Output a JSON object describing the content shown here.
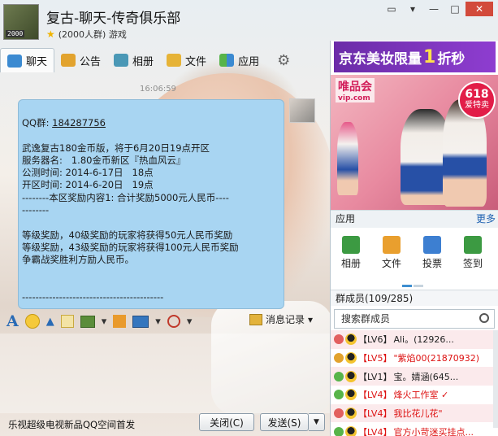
{
  "header": {
    "title": "复古-聊天-传奇俱乐部",
    "badge": "2000",
    "subtitle": "(2000人群) 游戏",
    "window_buttons": [
      "▭",
      "▾",
      "—",
      "□",
      "✕"
    ]
  },
  "tabs": [
    {
      "label": "聊天",
      "icon": "chat-icon"
    },
    {
      "label": "公告",
      "icon": "notice-icon"
    },
    {
      "label": "相册",
      "icon": "album-icon"
    },
    {
      "label": "文件",
      "icon": "folder-icon"
    },
    {
      "label": "应用",
      "icon": "apps-icon"
    }
  ],
  "message": {
    "timestamp": "16:06:59",
    "lines": [
      "QQ群: ",
      "",
      "武逸复古180金币版，将于6月20日19点开区",
      "服务器名:   1.80金币新区『热血风云』",
      "公测时间: 2014-6-17日   18点",
      "开区时间: 2014-6-20日   19点",
      "--------本区奖励内容1: 合计奖励5000元人民币----",
      "--------",
      "",
      "等级奖励，40级奖励的玩家将获得50元人民币奖励",
      "等级奖励，43级奖励的玩家将获得100元人民币奖励",
      "争霸战奖胜利方励人民币。",
      "",
      "",
      "------------------------------------------"
    ],
    "qq_number": "184287756"
  },
  "format_bar": {
    "history_label": "消息记录"
  },
  "bottom": {
    "promo_text": "乐视超级电视新品QQ空间首发",
    "close_label": "关闭(C)",
    "send_label": "发送(S)"
  },
  "side": {
    "ad_banner": {
      "pre": "京东美妆限量",
      "num": "1",
      "post": "折秒"
    },
    "photo_ad": {
      "logo": "唯品会",
      "logo_sub": "vip.com",
      "promo_top": "618",
      "promo_bottom": "爱特卖"
    },
    "apps_title": "应用",
    "apps_more": "更多",
    "apps": [
      {
        "label": "相册",
        "icon": "album-icon"
      },
      {
        "label": "文件",
        "icon": "folder-icon"
      },
      {
        "label": "投票",
        "icon": "vote-icon"
      },
      {
        "label": "签到",
        "icon": "checkin-icon"
      }
    ],
    "members_title": "群成员(109/285)",
    "member_search_placeholder": "搜索群成员",
    "members": [
      {
        "level": "【LV6】",
        "name": "Ali。(12926...",
        "name_color": "black",
        "level_color": "grey"
      },
      {
        "level": "【LV5】",
        "name": "\"紫焰00(21870932)",
        "name_color": "red",
        "level_color": "red"
      },
      {
        "level": "【LV1】",
        "name": "宝。婧涵(645...",
        "name_color": "black",
        "level_color": "grey"
      },
      {
        "level": "【LV4】",
        "name": "烽火工作室 ✓",
        "name_color": "red",
        "level_color": "red"
      },
      {
        "level": "【LV4】",
        "name": "我比花儿花\"",
        "name_color": "red",
        "level_color": "red"
      },
      {
        "level": "【LV4】",
        "name": "官方小苛迷买挂点...",
        "name_color": "red",
        "level_color": "red"
      }
    ]
  }
}
